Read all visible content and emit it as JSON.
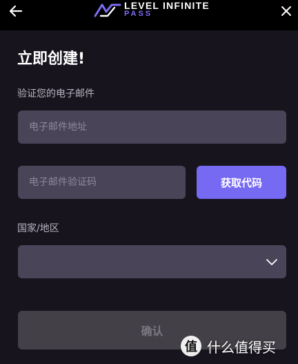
{
  "header": {
    "brand_line1": "LEVEL INFINITE",
    "brand_line2": "PASS"
  },
  "form": {
    "title": "立即创建!",
    "email_label": "验证您的电子邮件",
    "email_placeholder": "电子邮件地址",
    "code_placeholder": "电子邮件验证码",
    "get_code_label": "获取代码",
    "region_label": "国家/地区",
    "region_value": "",
    "confirm_label": "确认"
  },
  "watermark": {
    "icon_glyph": "值",
    "text": "什么值得买"
  },
  "colors": {
    "background": "#17141d",
    "topbar": "#000000",
    "field": "#4a4458",
    "accent": "#7669f2",
    "disabled_button": "#434047"
  }
}
